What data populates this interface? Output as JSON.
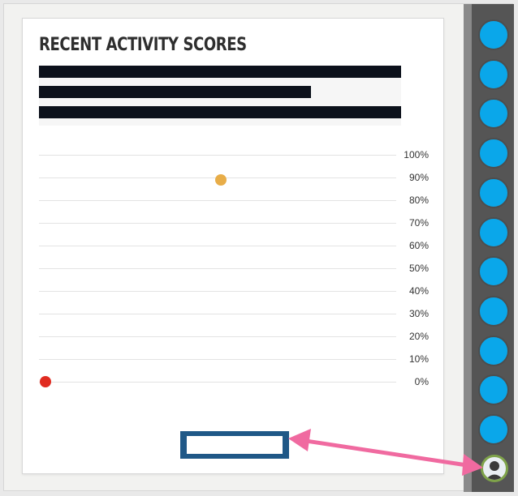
{
  "card": {
    "title": "RECENT ACTIVITY SCORES"
  },
  "chart_data": {
    "type": "scatter",
    "title": "",
    "ylim": [
      0,
      100
    ],
    "y_ticks": [
      "100%",
      "90%",
      "80%",
      "70%",
      "60%",
      "50%",
      "40%",
      "30%",
      "20%",
      "10%",
      "0%"
    ],
    "series": [
      {
        "values": [
          0
        ],
        "color": "#e02b20"
      },
      {
        "values": [
          89
        ],
        "color": "#e8ad48"
      }
    ],
    "grid": true
  },
  "button": {
    "label": ""
  },
  "sidebar": {
    "items": [
      {
        "icon": "circle-icon",
        "color": "#0aa7ea"
      },
      {
        "icon": "circle-icon",
        "color": "#0aa7ea"
      },
      {
        "icon": "circle-icon",
        "color": "#0aa7ea"
      },
      {
        "icon": "circle-icon",
        "color": "#0aa7ea"
      },
      {
        "icon": "circle-icon",
        "color": "#0aa7ea"
      },
      {
        "icon": "circle-icon",
        "color": "#0aa7ea"
      },
      {
        "icon": "circle-icon",
        "color": "#0aa7ea"
      },
      {
        "icon": "circle-icon",
        "color": "#0aa7ea"
      },
      {
        "icon": "circle-icon",
        "color": "#0aa7ea"
      },
      {
        "icon": "circle-icon",
        "color": "#0aa7ea"
      },
      {
        "icon": "circle-icon",
        "color": "#0aa7ea"
      }
    ],
    "avatar_icon": "user-avatar-icon"
  },
  "annotation": {
    "arrow_color": "#f06aa0"
  }
}
